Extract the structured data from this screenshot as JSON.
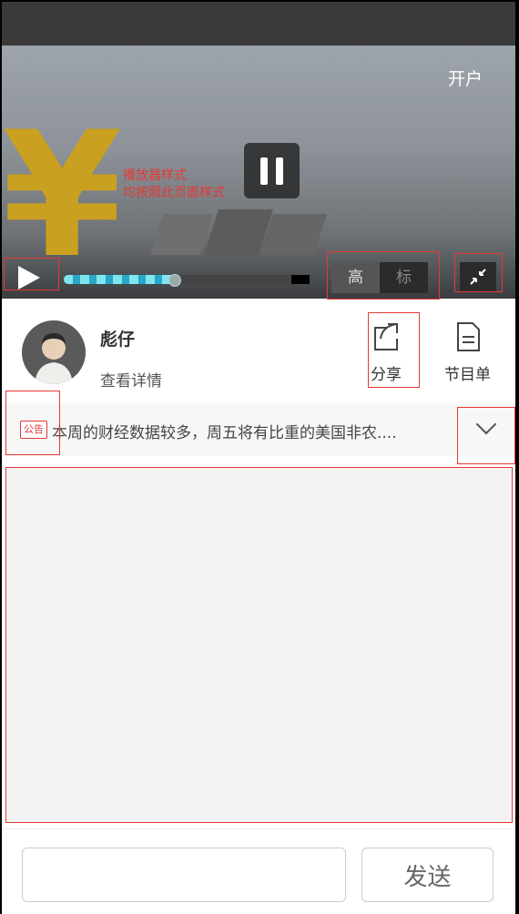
{
  "video": {
    "open_account_label": "开户",
    "annotation_lines": [
      "播放器样式",
      "均按照此页面样式"
    ],
    "progress_fraction": 0.45,
    "quality_options": [
      "高",
      "标"
    ],
    "selected_quality": "高"
  },
  "host": {
    "name": "彪仔",
    "detail_link": "查看详情",
    "share_label": "分享",
    "program_label": "节目单"
  },
  "notice": {
    "tag": "公告",
    "text": "本周的财经数据较多，周五将有比重的美国非农...."
  },
  "input_bar": {
    "placeholder": "",
    "send_label": "发送"
  },
  "icons": [
    "play-icon",
    "pause-icon",
    "exit-fullscreen-icon",
    "share-icon",
    "document-icon",
    "chevron-down-icon"
  ]
}
